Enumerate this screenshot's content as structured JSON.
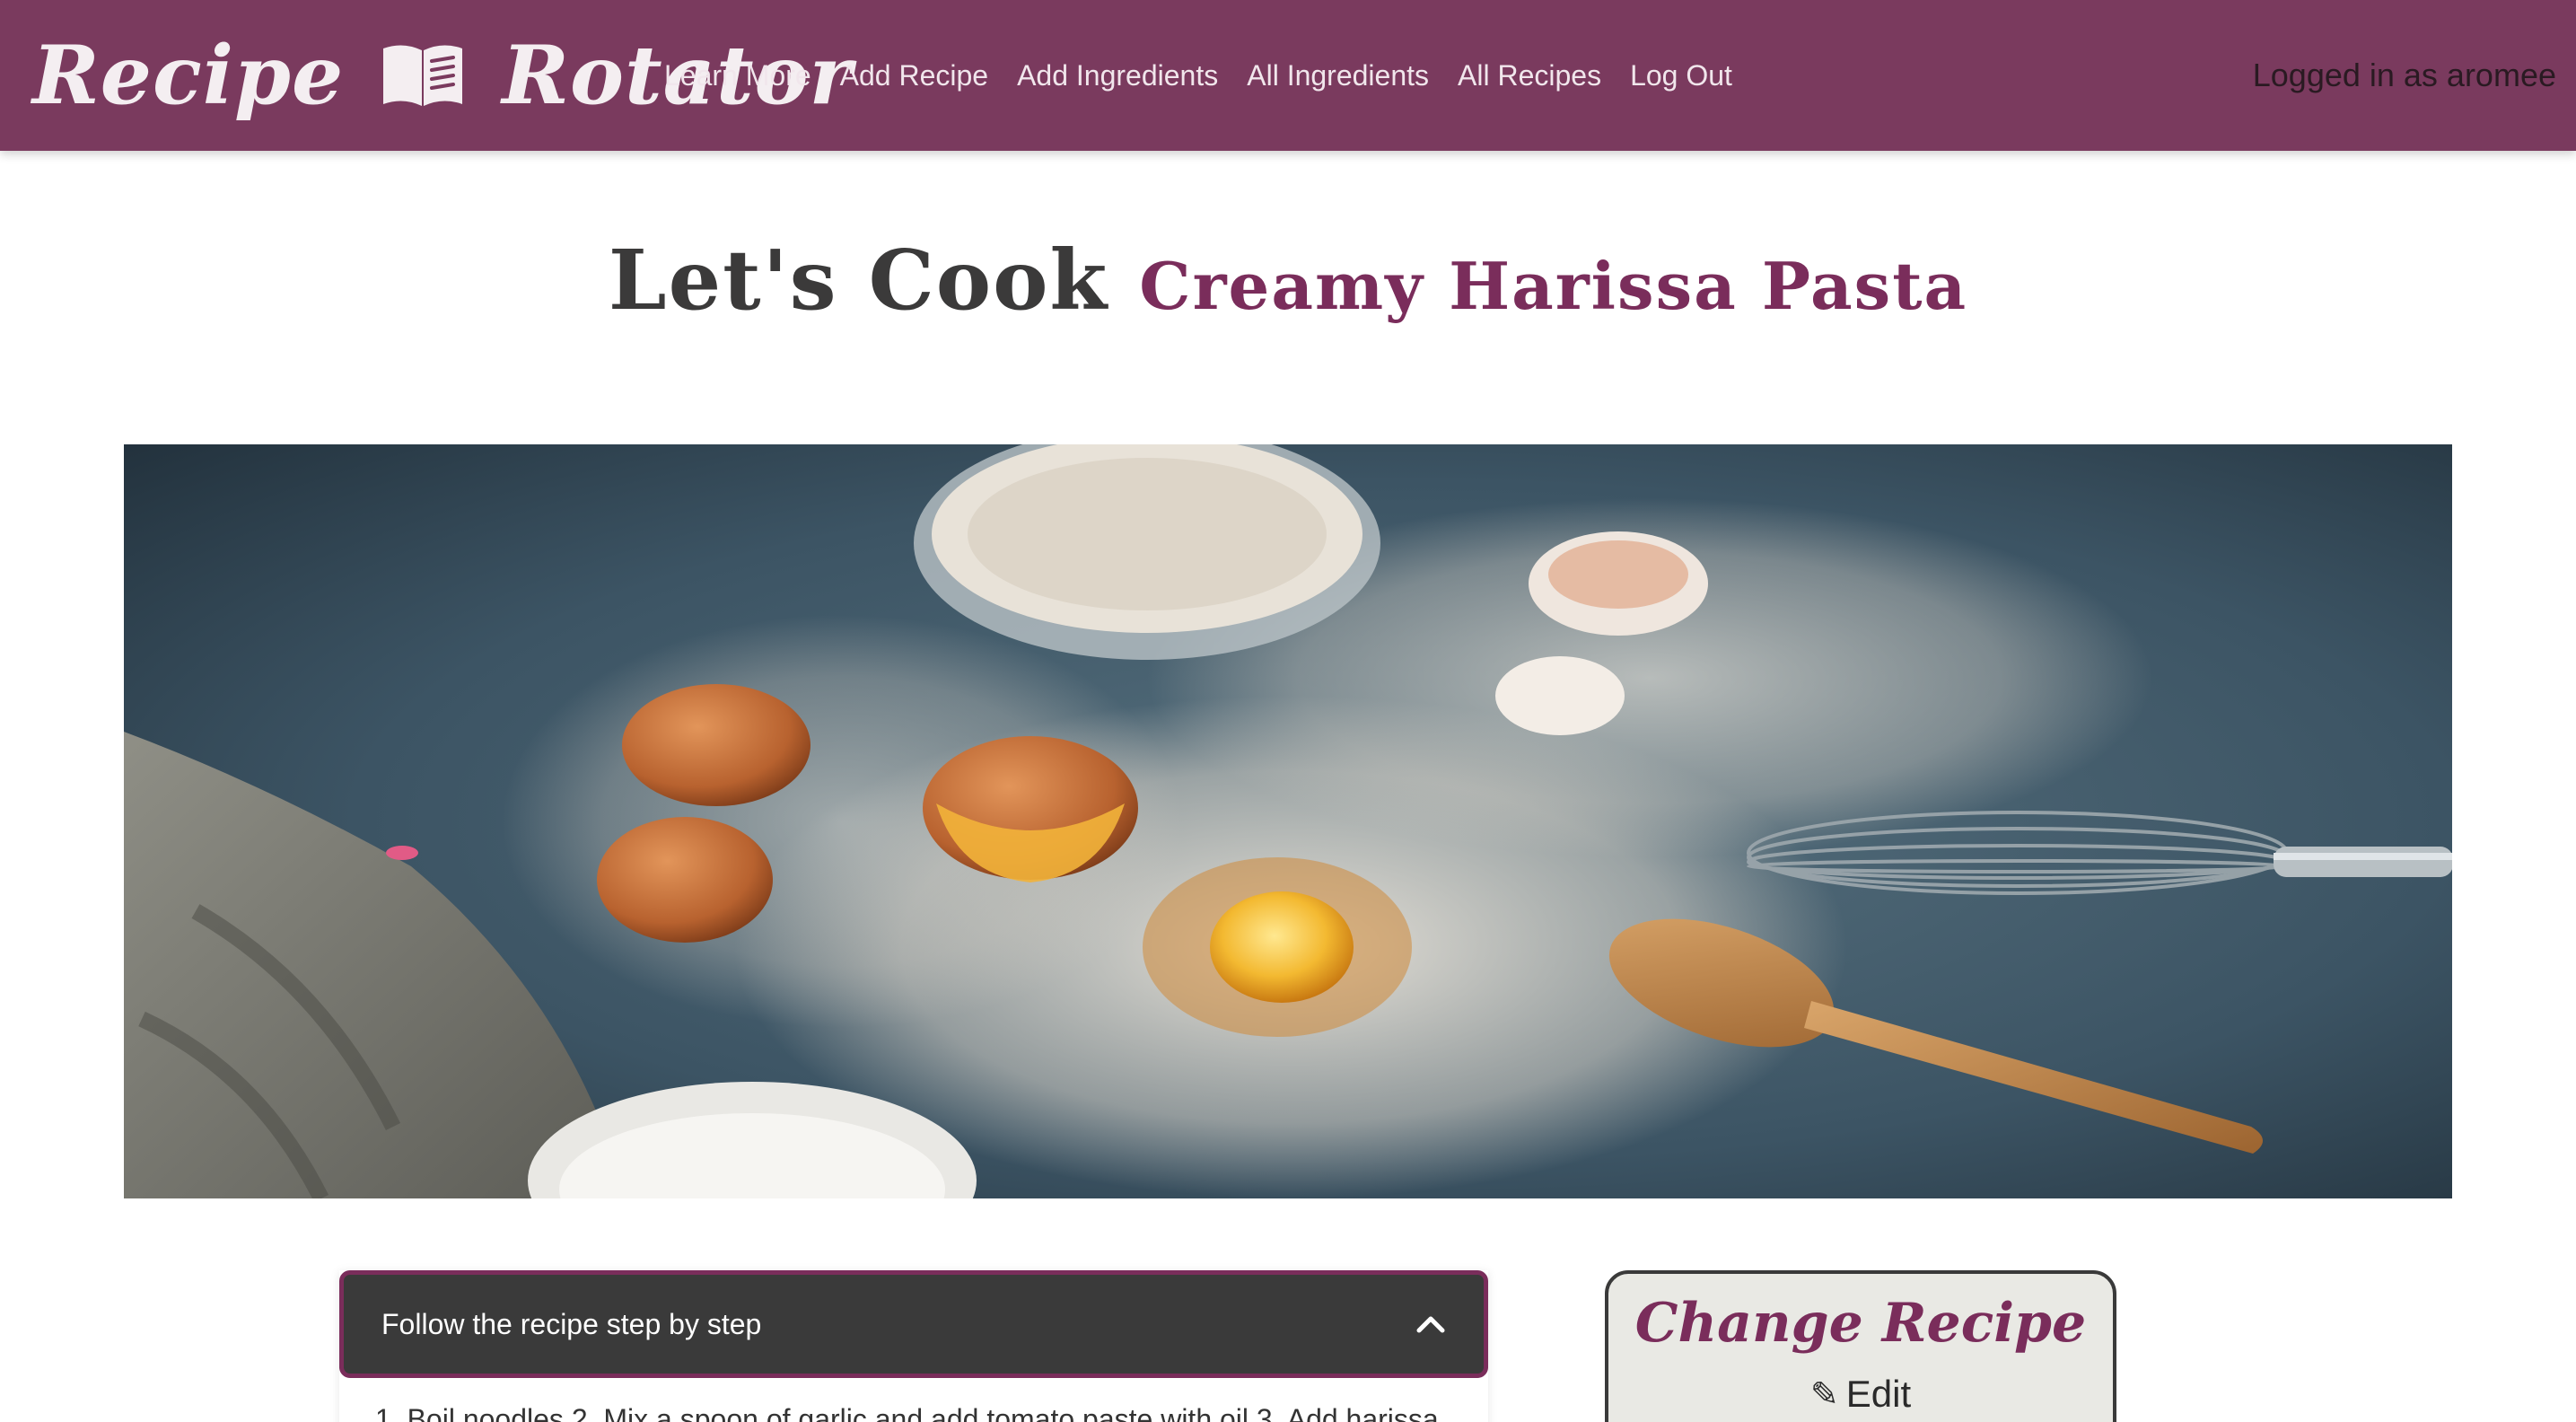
{
  "navbar": {
    "brand_left": "Recipe",
    "brand_right": "Rotator",
    "brand_icon": "open-book-icon",
    "links": [
      {
        "label": "Learn More"
      },
      {
        "label": "Add Recipe"
      },
      {
        "label": "Add Ingredients"
      },
      {
        "label": "All Ingredients"
      },
      {
        "label": "All Recipes"
      },
      {
        "label": "Log Out"
      }
    ],
    "user_status": "Logged in as aromee"
  },
  "heading": {
    "lead": "Let's Cook",
    "recipe_name": "Creamy Harissa Pasta"
  },
  "banner": {
    "icon": "cooking-ingredients-photo"
  },
  "steps": {
    "header_label": "Follow the recipe step by step",
    "toggle_icon": "chevron-up-icon",
    "body_text": "1. Boil noodles 2. Mix a spoon of garlic and add tomato paste with oil 3. Add harissa"
  },
  "change_recipe": {
    "title": "Change Recipe",
    "edit_label": "Edit",
    "edit_icon": "pencil-icon"
  },
  "colors": {
    "brand": "#7a3a5e",
    "accent": "#7a2d5b",
    "dark": "#3a3a3a"
  }
}
